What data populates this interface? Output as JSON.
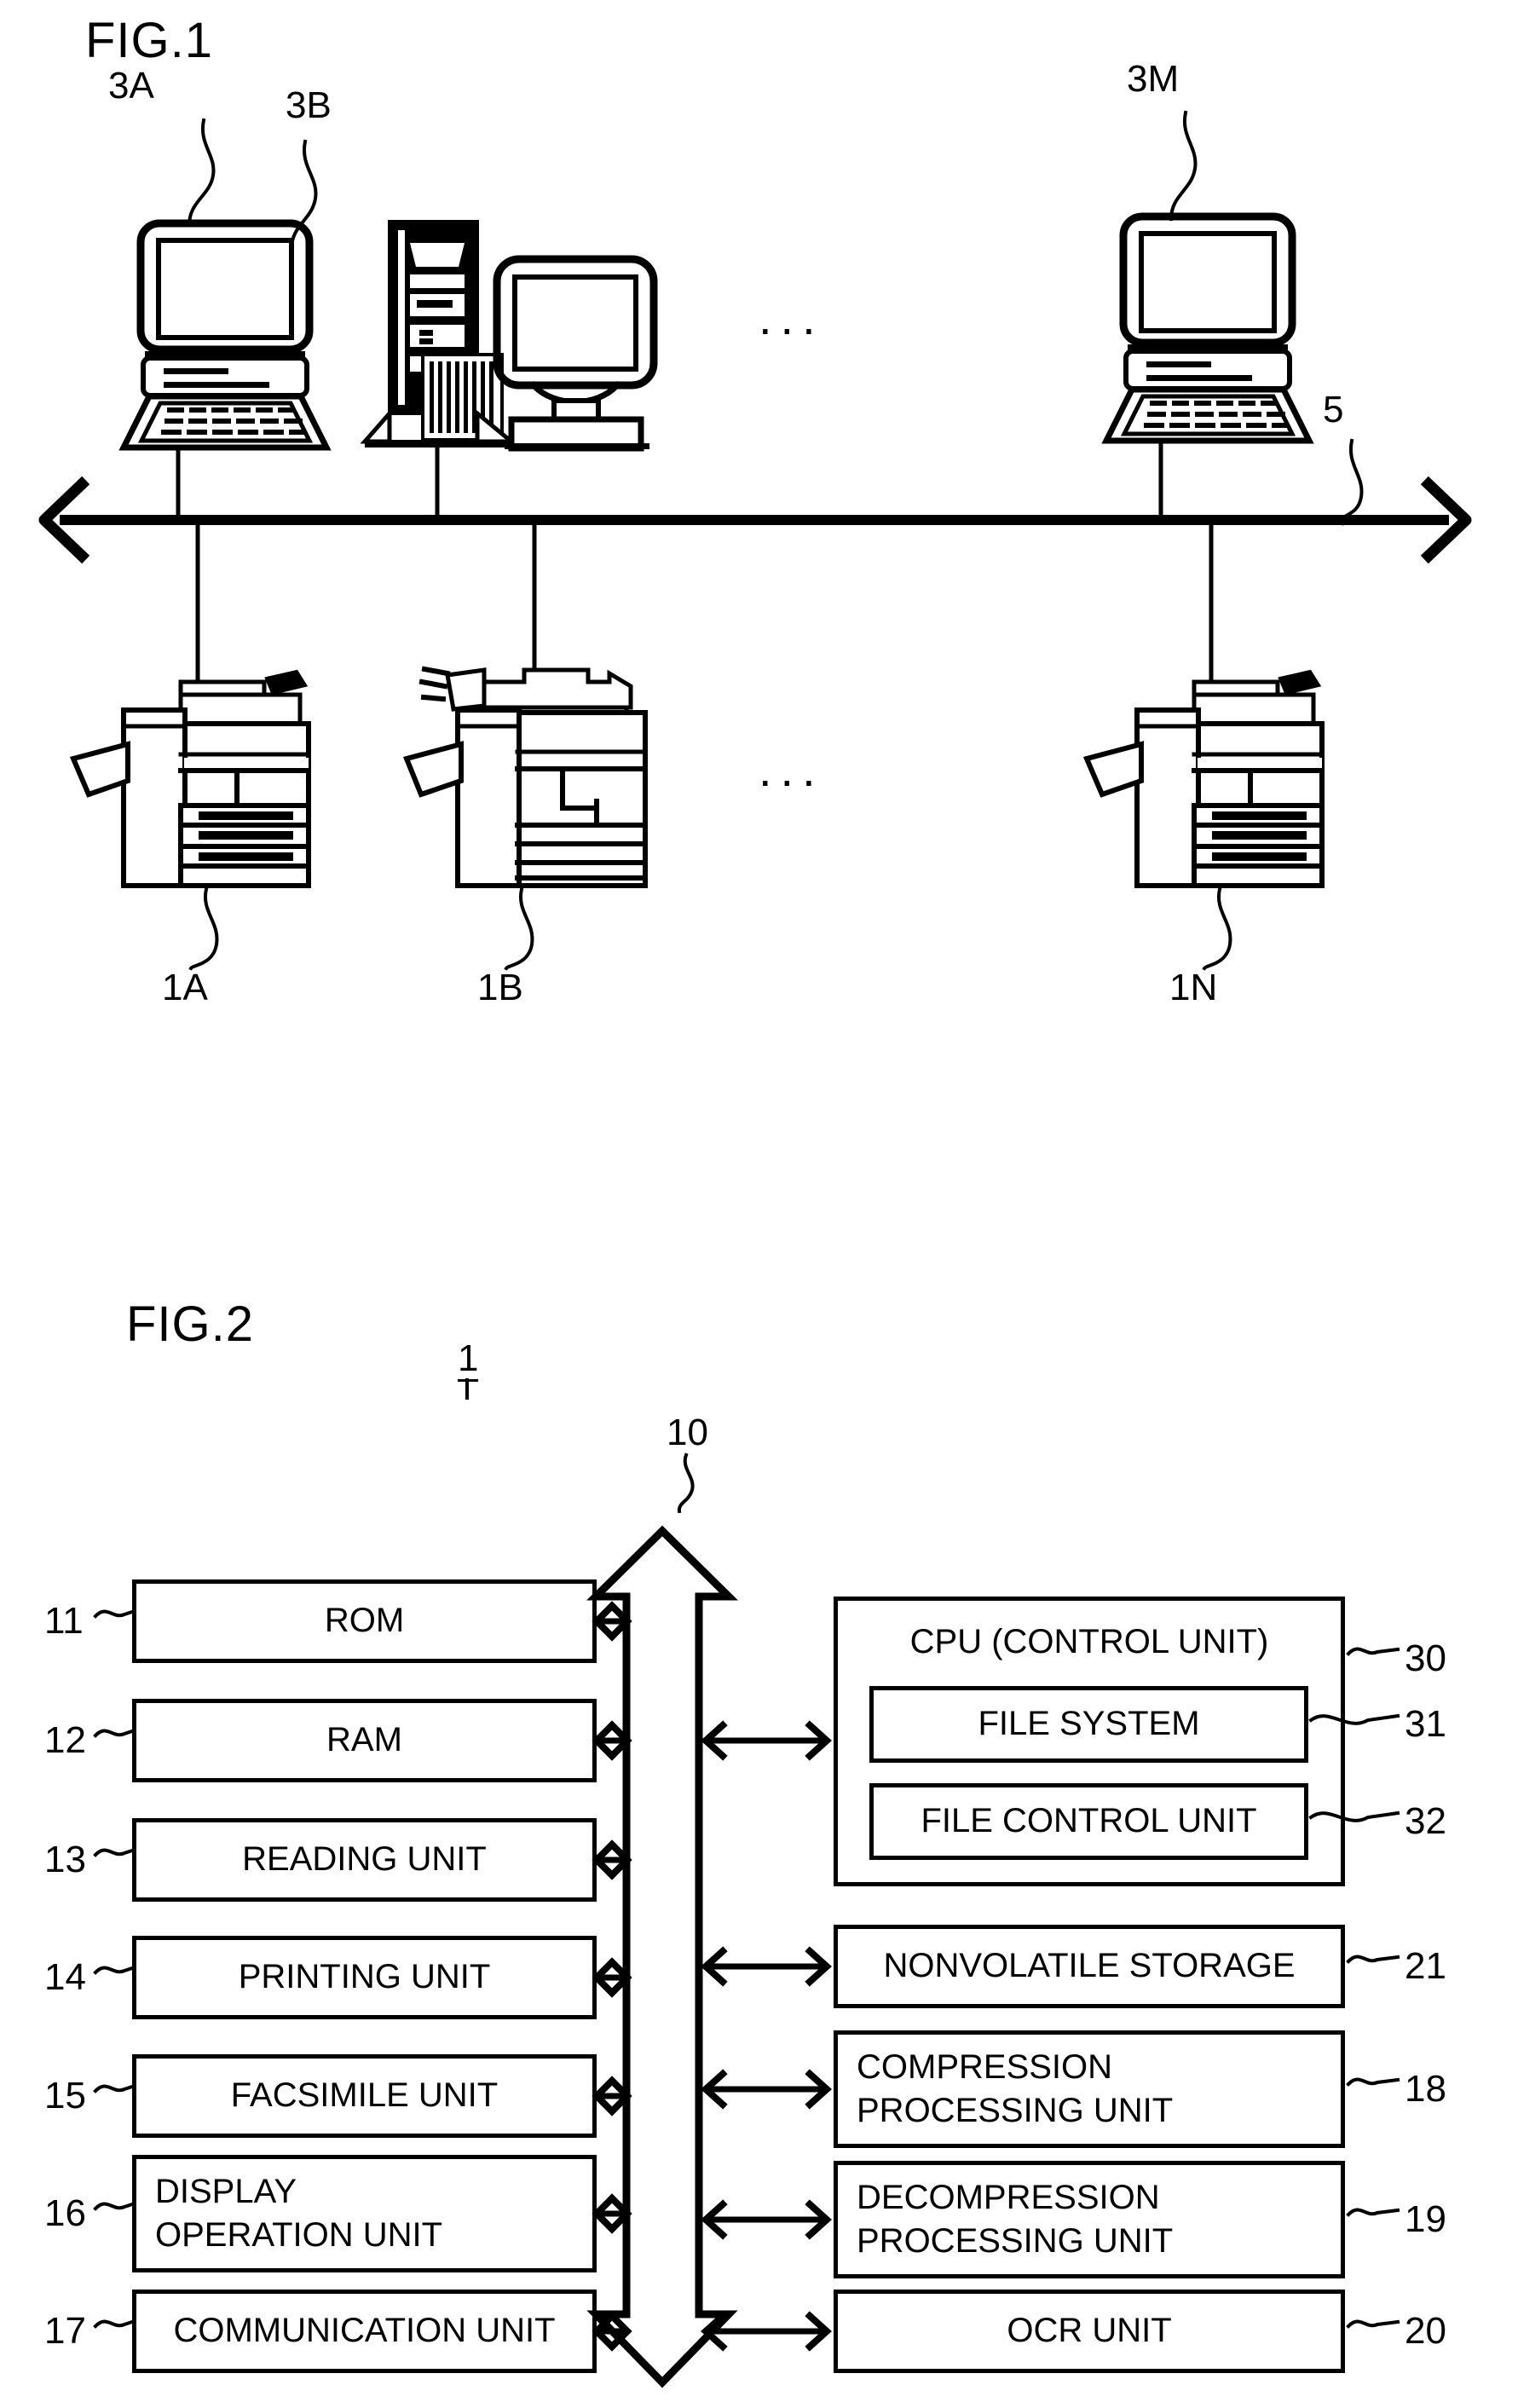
{
  "figures": {
    "fig1": {
      "title": "FIG.1",
      "network_label": "5",
      "ellipsis": "...",
      "clients": [
        {
          "id": "3A",
          "type": "laptop-computer"
        },
        {
          "id": "3B",
          "type": "desktop-computer-with-tower"
        },
        {
          "id": "3M",
          "type": "laptop-computer"
        }
      ],
      "devices": [
        {
          "id": "1A",
          "type": "multifunction-peripheral"
        },
        {
          "id": "1B",
          "type": "multifunction-peripheral"
        },
        {
          "id": "1N",
          "type": "multifunction-peripheral"
        }
      ]
    },
    "fig2": {
      "title": "FIG.2",
      "device_number": "1",
      "bus_label": "10",
      "left_blocks": [
        {
          "ref": "11",
          "label": "ROM"
        },
        {
          "ref": "12",
          "label": "RAM"
        },
        {
          "ref": "13",
          "label": "READING UNIT"
        },
        {
          "ref": "14",
          "label": "PRINTING UNIT"
        },
        {
          "ref": "15",
          "label": "FACSIMILE UNIT"
        },
        {
          "ref": "16",
          "label": "DISPLAY\nOPERATION UNIT"
        },
        {
          "ref": "17",
          "label": "COMMUNICATION UNIT"
        }
      ],
      "cpu": {
        "ref": "30",
        "label": "CPU (CONTROL UNIT)",
        "children": [
          {
            "ref": "31",
            "label": "FILE SYSTEM"
          },
          {
            "ref": "32",
            "label": "FILE CONTROL UNIT"
          }
        ]
      },
      "right_blocks": [
        {
          "ref": "21",
          "label": "NONVOLATILE STORAGE"
        },
        {
          "ref": "18",
          "label": "COMPRESSION\nPROCESSING UNIT"
        },
        {
          "ref": "19",
          "label": "DECOMPRESSION\nPROCESSING UNIT"
        },
        {
          "ref": "20",
          "label": "OCR UNIT"
        }
      ]
    }
  },
  "colors": {
    "ink": "#000000",
    "paper": "#ffffff"
  }
}
